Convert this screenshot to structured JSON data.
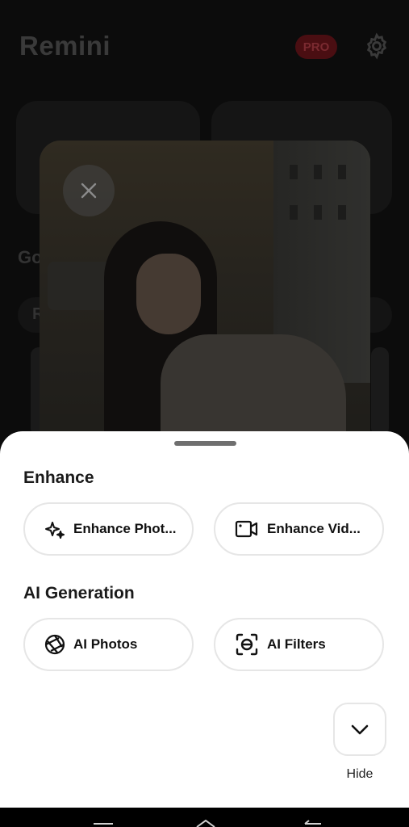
{
  "background": {
    "app_title": "Remini",
    "pro_badge": "PRO",
    "section_partial": "Go",
    "pill_partial": "R"
  },
  "sheet": {
    "enhance_title": "Enhance",
    "enhance_options": [
      {
        "label": "Enhance Phot...",
        "icon": "sparkle-icon"
      },
      {
        "label": "Enhance Vid...",
        "icon": "video-camera-icon"
      }
    ],
    "ai_title": "AI Generation",
    "ai_options": [
      {
        "label": "AI Photos",
        "icon": "aperture-icon"
      },
      {
        "label": "AI Filters",
        "icon": "face-scan-icon"
      }
    ],
    "hide_label": "Hide"
  },
  "colors": {
    "sheet_bg": "#ffffff",
    "border": "#e6e6e6",
    "pro_bg": "#4a0e12"
  }
}
